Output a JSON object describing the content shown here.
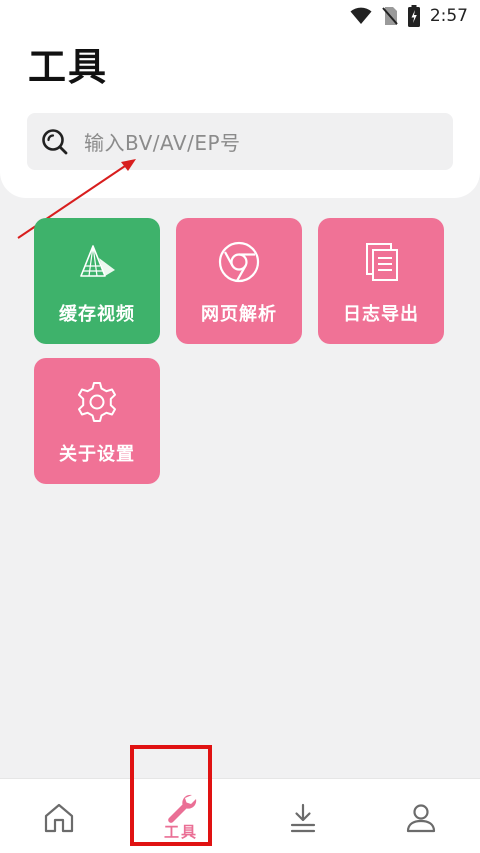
{
  "status_bar": {
    "time": "2:57",
    "icons": [
      "wifi-icon",
      "no-sim-icon",
      "battery-charging-icon"
    ]
  },
  "header": {
    "title": "工具"
  },
  "search": {
    "placeholder": "输入BV/AV/EP号",
    "icon": "search-icon"
  },
  "tools": [
    {
      "label": "缓存视频",
      "icon": "zongzi-icon",
      "color": "#3eb26b"
    },
    {
      "label": "网页解析",
      "icon": "chrome-icon",
      "color": "#f07296"
    },
    {
      "label": "日志导出",
      "icon": "documents-icon",
      "color": "#f07296"
    },
    {
      "label": "关于设置",
      "icon": "gear-icon",
      "color": "#f07296"
    }
  ],
  "bottom_nav": {
    "items": [
      {
        "icon": "home-icon",
        "label": "",
        "active": false
      },
      {
        "icon": "wrench-icon",
        "label": "工具",
        "active": true
      },
      {
        "icon": "download-icon",
        "label": "",
        "active": false
      },
      {
        "icon": "user-icon",
        "label": "",
        "active": false
      }
    ],
    "active_color": "#ea6f95",
    "inactive_color": "#6b6b6b"
  },
  "annotation": {
    "arrow_color": "#d81e1e",
    "highlight_color": "#e01212"
  }
}
